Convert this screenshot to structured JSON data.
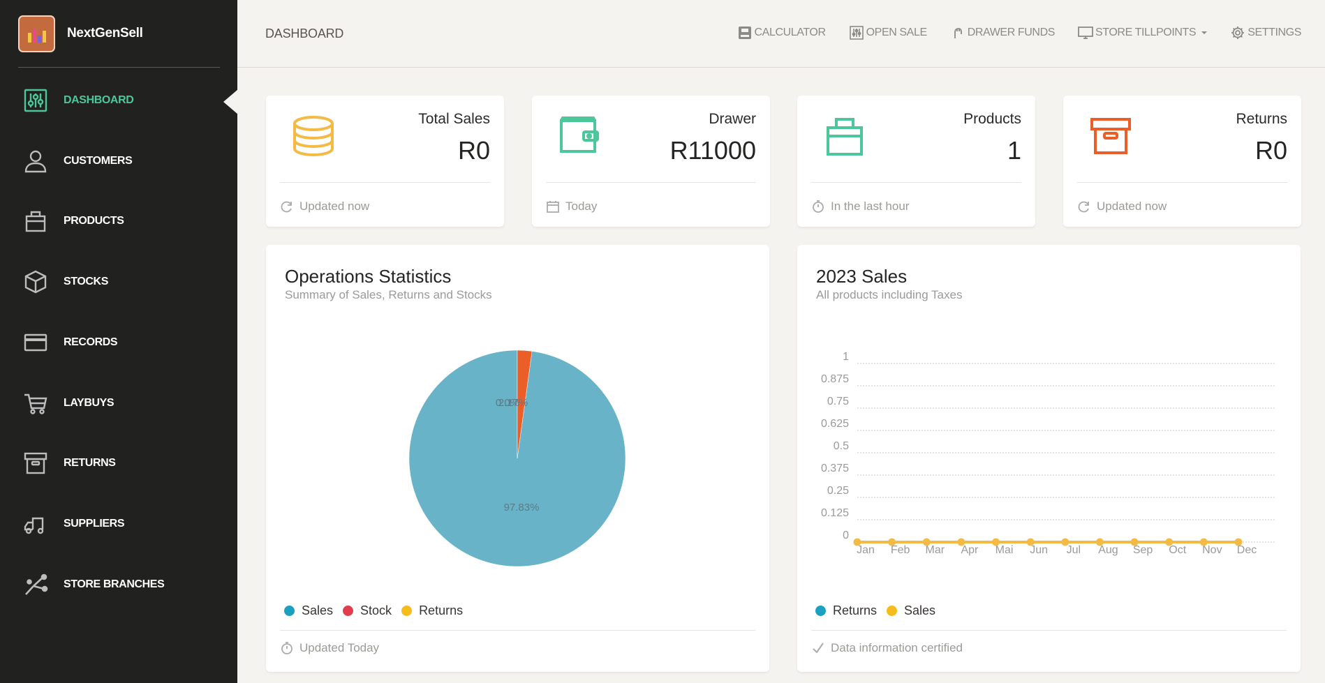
{
  "app": {
    "name": "NextGenSell"
  },
  "sidebar": {
    "items": [
      {
        "label": "DASHBOARD",
        "icon": "sliders-icon",
        "active": true
      },
      {
        "label": "CUSTOMERS",
        "icon": "user-icon"
      },
      {
        "label": "PRODUCTS",
        "icon": "bag-icon"
      },
      {
        "label": "STOCKS",
        "icon": "box-icon"
      },
      {
        "label": "RECORDS",
        "icon": "card-icon"
      },
      {
        "label": "LAYBUYS",
        "icon": "cart-icon"
      },
      {
        "label": "RETURNS",
        "icon": "archive-icon"
      },
      {
        "label": "SUPPLIERS",
        "icon": "truck-icon"
      },
      {
        "label": "STORE BRANCHES",
        "icon": "branch-icon"
      }
    ]
  },
  "header": {
    "title": "DASHBOARD",
    "actions": [
      {
        "label": "CALCULATOR",
        "icon": "calculator-icon"
      },
      {
        "label": "OPEN SALE",
        "icon": "open-sale-icon"
      },
      {
        "label": "DRAWER FUNDS",
        "icon": "hand-icon"
      },
      {
        "label": "STORE TILLPOINTS",
        "icon": "monitor-icon",
        "dropdown": true
      },
      {
        "label": "SETTINGS",
        "icon": "gear-icon"
      }
    ]
  },
  "stats": [
    {
      "label": "Total Sales",
      "value": "R0",
      "footer": "Updated now",
      "icon": "coins-icon",
      "footer_icon": "refresh-icon",
      "color": "#f3bb45"
    },
    {
      "label": "Drawer",
      "value": "R11000",
      "footer": "Today",
      "icon": "wallet-icon",
      "footer_icon": "calendar-icon",
      "color": "#4cc79b"
    },
    {
      "label": "Products",
      "value": "1",
      "footer": "In the last hour",
      "icon": "bag-icon",
      "footer_icon": "timer-icon",
      "color": "#4cc79b"
    },
    {
      "label": "Returns",
      "value": "R0",
      "footer": "Updated now",
      "icon": "archive-icon",
      "footer_icon": "refresh-icon",
      "color": "#eb5e28"
    }
  ],
  "operations_panel": {
    "title": "Operations Statistics",
    "subtitle": "Summary of Sales, Returns and Stocks",
    "footer": "Updated Today",
    "legend": [
      {
        "label": "Sales",
        "color": "#1ba1bf"
      },
      {
        "label": "Stock",
        "color": "#e23d4f"
      },
      {
        "label": "Returns",
        "color": "#f5bc1e"
      }
    ]
  },
  "sales_panel": {
    "title": "2023 Sales",
    "subtitle": "All products including Taxes",
    "footer": "Data information certified",
    "legend": [
      {
        "label": "Returns",
        "color": "#1ba1bf"
      },
      {
        "label": "Sales",
        "color": "#f5bc1e"
      }
    ]
  },
  "chart_data": [
    {
      "type": "pie",
      "slices": [
        {
          "value": 97.83,
          "label": "97.83%",
          "color": "#68b3c8"
        },
        {
          "value": 2.17,
          "label": "2.17%",
          "color": "#eb5e28"
        },
        {
          "value": 0,
          "label": "0.0%",
          "color": "#f3bb45"
        }
      ]
    },
    {
      "type": "line",
      "categories": [
        "Jan",
        "Feb",
        "Mar",
        "Apr",
        "Mai",
        "Jun",
        "Jul",
        "Aug",
        "Sep",
        "Oct",
        "Nov",
        "Dec"
      ],
      "yticks": [
        "0",
        "0.125",
        "0.25",
        "0.375",
        "0.5",
        "0.625",
        "0.75",
        "0.875",
        "1"
      ],
      "ylim": [
        0,
        1
      ],
      "series": [
        {
          "name": "Sales",
          "values": [
            0,
            0,
            0,
            0,
            0,
            0,
            0,
            0,
            0,
            0,
            0,
            0
          ],
          "color": "#f3bb45"
        }
      ]
    }
  ]
}
